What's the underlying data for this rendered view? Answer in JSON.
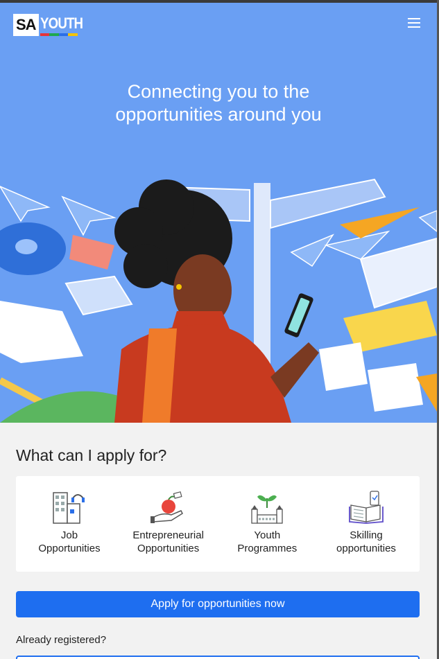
{
  "header": {
    "logo_sa": "SA",
    "logo_youth": "YOUTH",
    "logo_bar_colors": [
      "#e5343a",
      "#1fa84f",
      "#2b6fe8",
      "#f5c400"
    ],
    "menu_icon": "hamburger-menu-icon"
  },
  "hero": {
    "title_line1": "Connecting you to the",
    "title_line2": "opportunities around you",
    "background_color": "#6a9ff3"
  },
  "categories_section": {
    "title": "What can I apply for?",
    "items": [
      {
        "line1": "Job",
        "line2": "Opportunities",
        "icon": "office-building-headset-icon"
      },
      {
        "line1": "Entrepreneurial",
        "line2": "Opportunities",
        "icon": "hand-holding-apple-icon"
      },
      {
        "line1": "Youth",
        "line2": "Programmes",
        "icon": "sprouting-plant-building-icon"
      },
      {
        "line1": "Skilling",
        "line2": "opportunities",
        "icon": "book-and-tablet-icon"
      }
    ]
  },
  "cta": {
    "apply_label": "Apply for opportunities now",
    "already_registered": "Already registered?",
    "primary_color": "#1e6ef0"
  }
}
